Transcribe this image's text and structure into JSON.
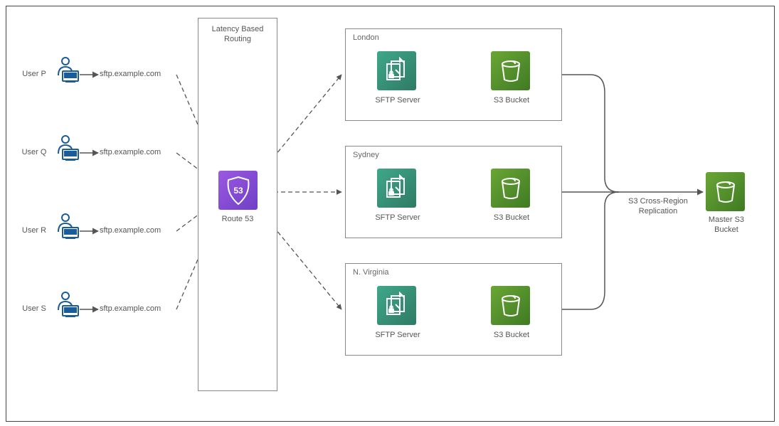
{
  "users": [
    {
      "name": "User P",
      "domain": "sftp.example.com"
    },
    {
      "name": "User Q",
      "domain": "sftp.example.com"
    },
    {
      "name": "User R",
      "domain": "sftp.example.com"
    },
    {
      "name": "User S",
      "domain": "sftp.example.com"
    }
  ],
  "routing": {
    "title": "Latency Based Routing",
    "service_label": "Route 53"
  },
  "regions": [
    {
      "name": "London",
      "sftp_label": "SFTP Server",
      "bucket_label": "S3 Bucket"
    },
    {
      "name": "Sydney",
      "sftp_label": "SFTP Server",
      "bucket_label": "S3 Bucket"
    },
    {
      "name": "N. Virginia",
      "sftp_label": "SFTP Server",
      "bucket_label": "S3 Bucket"
    }
  ],
  "replication": {
    "label": "S3 Cross-Region Replication"
  },
  "master": {
    "label": "Master S3 Bucket"
  }
}
